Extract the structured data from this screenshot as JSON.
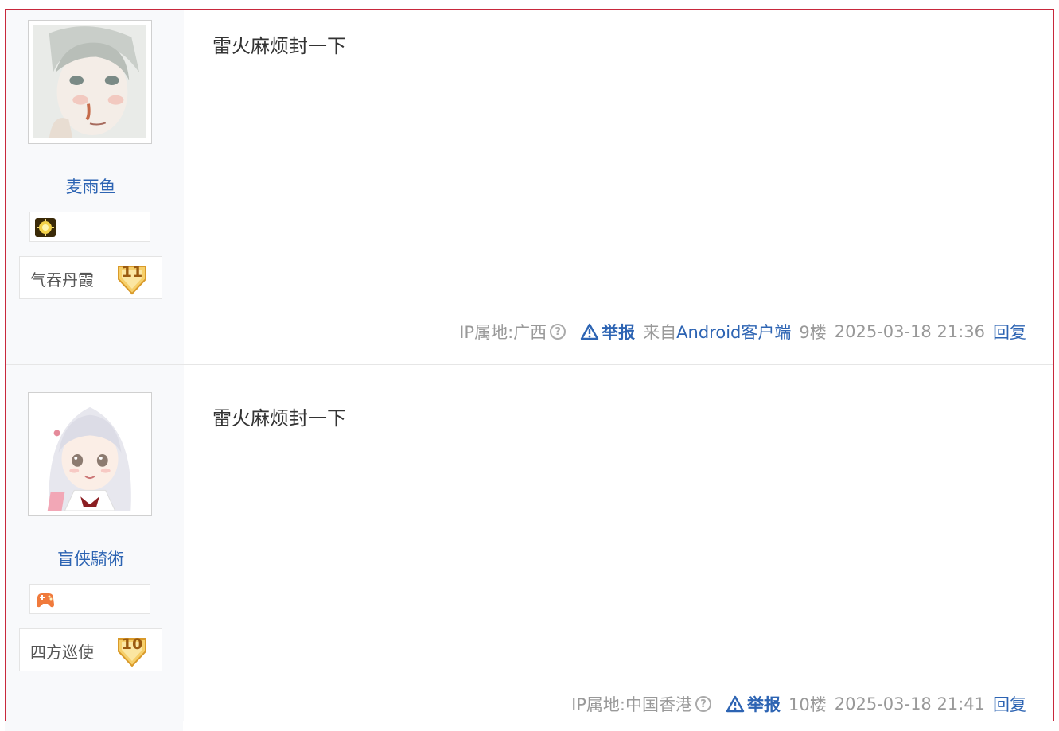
{
  "posts": [
    {
      "username": "麦雨鱼",
      "level_name": "气吞丹霞",
      "level": "11",
      "content": "雷火麻烦封一下",
      "ip_label": "IP属地:广西",
      "report_label": "举报",
      "from_prefix": "来自",
      "client": "Android客户端",
      "floor": "9楼",
      "time": "2025-03-18 21:36",
      "reply_label": "回复"
    },
    {
      "username": "盲侠騎術",
      "level_name": "四方巡使",
      "level": "10",
      "content": "雷火麻烦封一下",
      "ip_label": "IP属地:中国香港",
      "report_label": "举报",
      "floor": "10楼",
      "time": "2025-03-18 21:41",
      "reply_label": "回复"
    }
  ],
  "colors": {
    "link": "#2d64b3",
    "frame_border": "#c8283c",
    "author_bg": "#f8f9fb",
    "meta_gray": "#999999"
  },
  "icons": {
    "post1_badge": "sun-badge-icon",
    "post2_badge": "gamepad-badge-icon",
    "level_badge": "shield-level-icon",
    "report": "warning-triangle-icon",
    "ip_help": "question-circle-icon"
  }
}
